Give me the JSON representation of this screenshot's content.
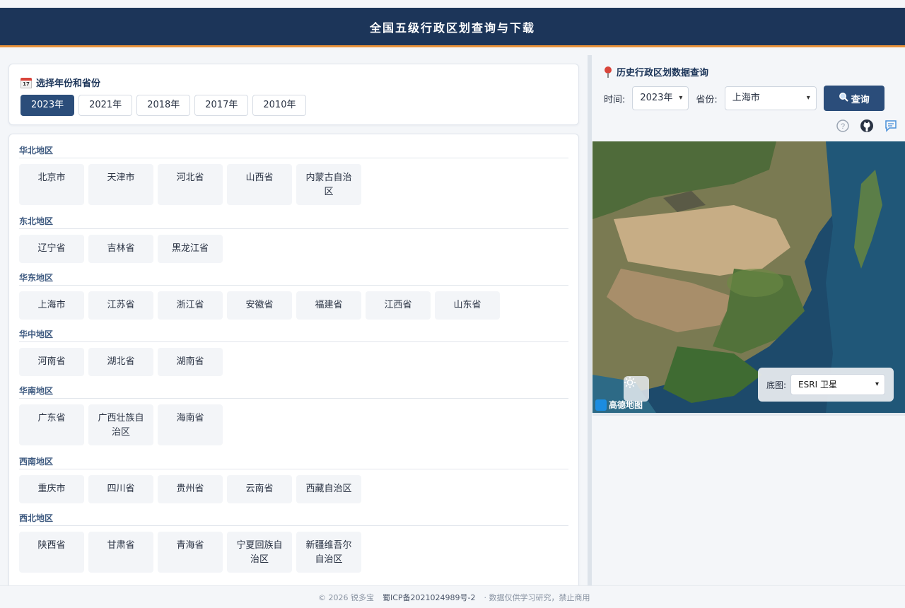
{
  "header": {
    "title": "全国五级行政区划查询与下载"
  },
  "year_panel": {
    "title": "选择年份和省份",
    "calendar_icon_text": "17",
    "years": [
      "2023年",
      "2021年",
      "2018年",
      "2017年",
      "2010年"
    ],
    "active_year": "2023年"
  },
  "regions": [
    {
      "name": "华北地区",
      "provinces": [
        "北京市",
        "天津市",
        "河北省",
        "山西省",
        "内蒙古自治区"
      ]
    },
    {
      "name": "东北地区",
      "provinces": [
        "辽宁省",
        "吉林省",
        "黑龙江省"
      ]
    },
    {
      "name": "华东地区",
      "provinces": [
        "上海市",
        "江苏省",
        "浙江省",
        "安徽省",
        "福建省",
        "江西省",
        "山东省"
      ]
    },
    {
      "name": "华中地区",
      "provinces": [
        "河南省",
        "湖北省",
        "湖南省"
      ]
    },
    {
      "name": "华南地区",
      "provinces": [
        "广东省",
        "广西壮族自治区",
        "海南省"
      ]
    },
    {
      "name": "西南地区",
      "provinces": [
        "重庆市",
        "四川省",
        "贵州省",
        "云南省",
        "西藏自治区"
      ]
    },
    {
      "name": "西北地区",
      "provinces": [
        "陕西省",
        "甘肃省",
        "青海省",
        "宁夏回族自治区",
        "新疆维吾尔自治区"
      ]
    }
  ],
  "query_panel": {
    "title": "历史行政区划数据查询",
    "time_label": "时间:",
    "year_value": "2023年",
    "province_label": "省份:",
    "province_value": "上海市",
    "query_button": "查询"
  },
  "map": {
    "basemap_label": "底图:",
    "basemap_value": "ESRI 卫星",
    "provider_logo": "高德地图"
  },
  "footer": {
    "copyright": "© 2026 锐多宝",
    "icp": "蜀ICP备2021024989号-2",
    "notice": "· 数据仅供学习研究，禁止商用"
  }
}
